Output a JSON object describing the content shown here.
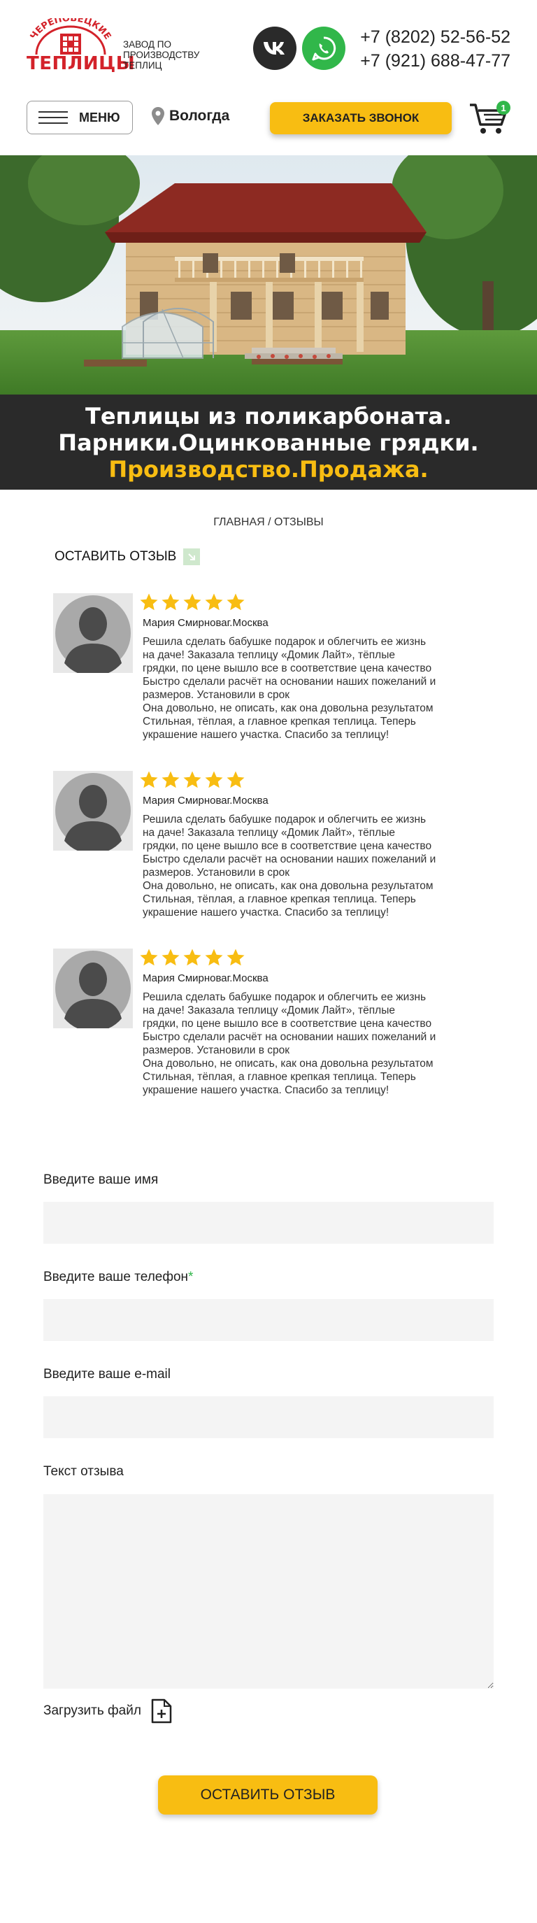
{
  "header": {
    "logo_top": "ЧЕРЕПОВЕЦКИЕ",
    "logo_bottom": "ТЕПЛИЦЫ",
    "tagline": "ЗАВОД ПО ПРОИЗВОДСТВУ ТЕПЛИЦ",
    "phone_1": "+7 (8202) 52-56-52",
    "phone_2": "+7 (921) 688-47-77",
    "menu_label": "МЕНЮ",
    "city": "Вологда",
    "callback_label": "ЗАКАЗАТЬ ЗВОНОК",
    "cart_count": "1",
    "icons": {
      "vk": "vk-icon",
      "whatsapp": "whatsapp-icon",
      "location": "location-pin-icon",
      "cart": "cart-icon",
      "burger": "burger-menu-icon"
    }
  },
  "hero": {
    "line_1": "Теплицы из поликарбоната.",
    "line_2": "Парники.Оцинкованные грядки.",
    "line_3": "Производство.Продажа."
  },
  "breadcrumb": "ГЛАВНАЯ / ОТЗЫВЫ",
  "leave_review": "ОСТАВИТЬ ОТЗЫВ",
  "reviews": [
    {
      "rating": 5,
      "author": "Мария Смирноваг.Москва",
      "text": "Решила сделать бабушке подарок и облегчить ее жизнь\nна даче! Заказала теплицу «Домик Лайт», тёплые\nгрядки, по цене вышло все в соответствие цена качество\nБыстро сделали расчёт на основании наших пожеланий и\nразмеров. Установили в срок\nОна довольно, не описать, как она довольна результатом\nСтильная, тёплая, а главное крепкая теплица. Теперь\nукрашение нашего участка. Спасибо за теплицу!"
    },
    {
      "rating": 5,
      "author": "Мария Смирноваг.Москва",
      "text": "Решила сделать бабушке подарок и облегчить ее жизнь\nна даче! Заказала теплицу «Домик Лайт», тёплые\nгрядки, по цене вышло все в соответствие цена качество\nБыстро сделали расчёт на основании наших пожеланий и\nразмеров. Установили в срок\nОна довольно, не описать, как она довольна результатом\nСтильная, тёплая, а главное крепкая теплица. Теперь\nукрашение нашего участка. Спасибо за теплицу!"
    },
    {
      "rating": 5,
      "author": "Мария Смирноваг.Москва",
      "text": "Решила сделать бабушке подарок и облегчить ее жизнь\nна даче! Заказала теплицу «Домик Лайт», тёплые\nгрядки, по цене вышло все в соответствие цена качество\nБыстро сделали расчёт на основании наших пожеланий и\nразмеров. Установили в срок\nОна довольно, не описать, как она довольна результатом\nСтильная, тёплая, а главное крепкая теплица. Теперь\nукрашение нашего участка. Спасибо за теплицу!"
    }
  ],
  "form": {
    "name_label": "Введите ваше имя",
    "phone_label": "Введите ваше телефон",
    "phone_required_mark": "*",
    "email_label": "Введите ваше e-mail",
    "text_label": "Текст отзыва",
    "name_value": "",
    "phone_value": "",
    "email_value": "",
    "text_value": "",
    "upload_label": "Загрузить файл",
    "submit_label": "ОСТАВИТЬ ОТЗЫВ"
  },
  "colors": {
    "accent_yellow": "#f8bd12",
    "brand_red": "#d3222a",
    "whatsapp_green": "#31b74a",
    "banner_dark": "#2a2a2a",
    "star": "#f8bd12"
  }
}
